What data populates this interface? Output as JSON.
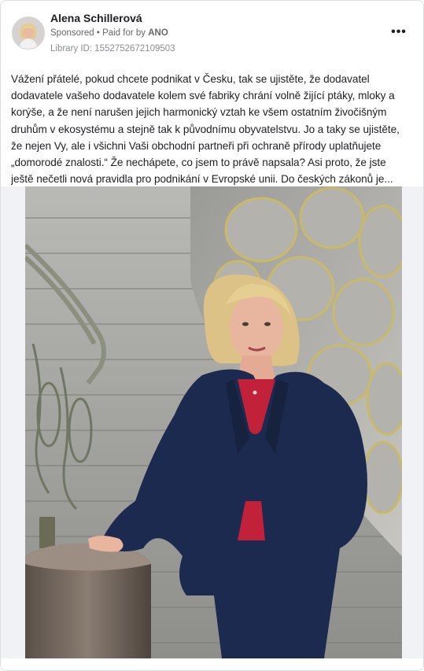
{
  "post": {
    "author_name": "Alena Schillerová",
    "sponsored_label": "Sponsored",
    "meta_separator": "•",
    "paid_for_prefix": "Paid for by",
    "paid_for_by": "ANO",
    "library_id": "Library ID: 1552752672109503",
    "more_icon": "•••",
    "body_lines": [
      "Vážení přátelé, pokud chcete podnikat v Česku, tak se ujistěte, že dodavatel",
      "dodavatele vašeho dodavatele kolem své fabriky chrání volně žijící ptáky, mloky a",
      "korýše, a že není narušen jejich harmonický vztah ke všem ostatním živočišným",
      "druhům v ekosystému a stejně tak k původnímu obyvatelstvu. Jo a taky se ujistěte,",
      "že nejen Vy, ale i všichni Vaši obchodní partneři při ochraně přírody uplatňujete",
      "„domorodé znalosti.“ Že nechápete, co jsem to právě napsala? Asi proto, že jste",
      "ještě nečetli nová pravidla pro podnikání v Evropské unii. Do českých zákonů je..."
    ]
  },
  "icons": {
    "avatar": "avatar-portrait",
    "more": "more-options-icon"
  },
  "colors": {
    "text": "#1c1e21",
    "secondary_text": "#65676b",
    "suit": "#1d2a4f",
    "top": "#c2213a",
    "background": "#f0f2f5"
  }
}
